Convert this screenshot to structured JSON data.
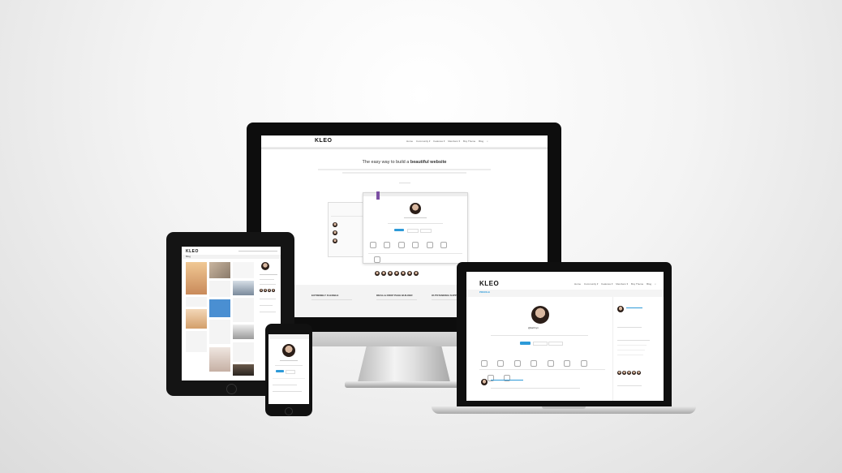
{
  "brand": {
    "logo_text": "KLEO",
    "accent_color": "#2d9ad8",
    "purple_accent": "#7b4fa3"
  },
  "imac": {
    "nav_items": [
      "Home",
      "Community ▾",
      "Features ▾",
      "Members ▾",
      "Buy Theme",
      "Blog"
    ],
    "headline_prefix": "The easy way to build a ",
    "headline_bold": "beautiful website",
    "features": [
      "EXTREMELY FLEXIBLE",
      "DRAG & DROP PAGE BUILDER",
      "OUTSTANDING SUPPO"
    ]
  },
  "ipad": {
    "logo_text": "KLEO",
    "page_label": "Blog"
  },
  "macbook": {
    "logo_text": "KLEO",
    "nav_items": [
      "Home",
      "Community ▾",
      "Features ▾",
      "Members ▾",
      "Buy Theme",
      "Blog"
    ],
    "profile_label": "PROFILE",
    "profile_name": "@kathryn"
  },
  "icons": [
    "search-icon",
    "avatar-icon",
    "home-button-icon"
  ]
}
